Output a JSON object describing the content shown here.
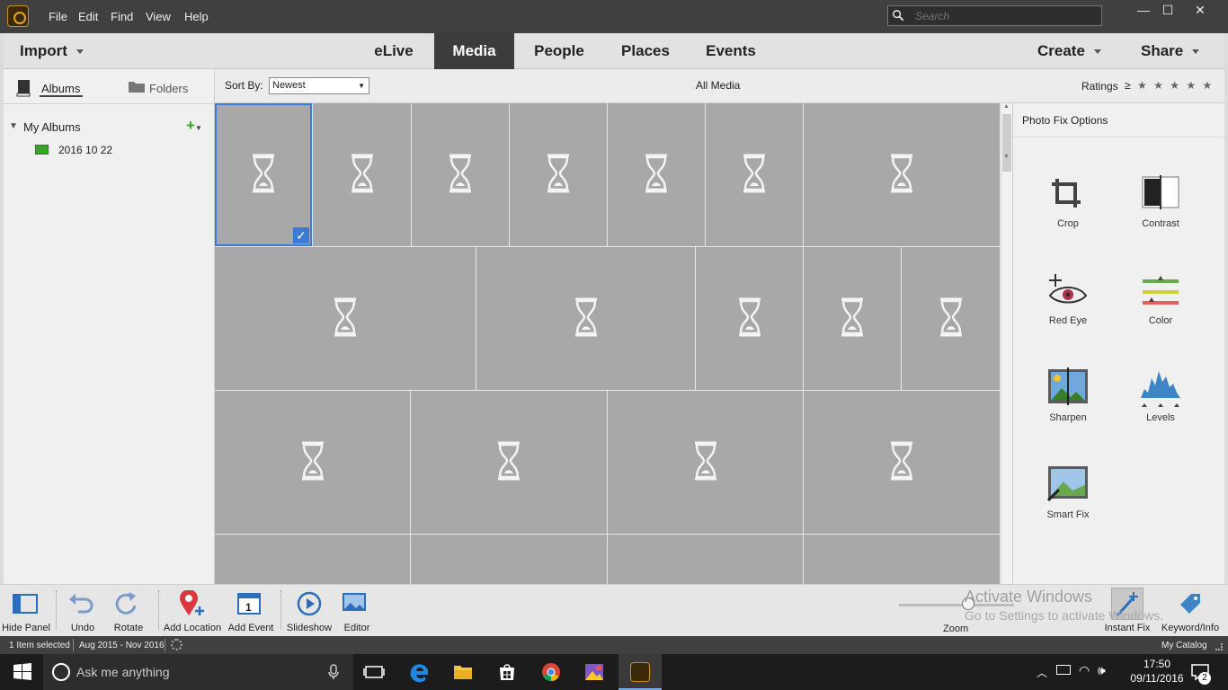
{
  "titlebar": {
    "menus": [
      "File",
      "Edit",
      "Find",
      "View",
      "Help"
    ],
    "search_placeholder": "Search",
    "window_controls": {
      "minimize": "—",
      "maximize": "☐",
      "close": "✕"
    }
  },
  "navbar": {
    "import_label": "Import",
    "tabs": [
      "eLive",
      "Media",
      "People",
      "Places",
      "Events"
    ],
    "active_tab": "Media",
    "create_label": "Create",
    "share_label": "Share"
  },
  "leftpanel": {
    "albums_label": "Albums",
    "folders_label": "Folders",
    "my_albums_label": "My Albums",
    "albums": [
      "2016 10 22"
    ]
  },
  "filterbar": {
    "sort_label": "Sort By:",
    "sort_value": "Newest",
    "view_title": "All Media",
    "ratings_label": "Ratings",
    "ratings_op": "≥"
  },
  "rightpanel": {
    "header": "Photo Fix Options",
    "tools": [
      "Crop",
      "Contrast",
      "Red Eye",
      "Color",
      "Sharpen",
      "Levels",
      "Smart Fix"
    ]
  },
  "bottombar": {
    "tools": [
      "Hide Panel",
      "Undo",
      "Rotate",
      "Add Location",
      "Add Event",
      "Slideshow",
      "Editor"
    ],
    "zoom_label": "Zoom",
    "instant_fix_label": "Instant Fix",
    "keyword_info_label": "Keyword/Info",
    "watermark_line1": "Activate Windows",
    "watermark_line2": "Go to Settings to activate Windows."
  },
  "statusbar": {
    "selection": "1 Item selected",
    "date_range": "Aug 2015 - Nov 2016",
    "catalog": "My Catalog"
  },
  "taskbar": {
    "cortana_placeholder": "Ask me anything",
    "time": "17:50",
    "date": "09/11/2016",
    "notification_count": "2"
  },
  "colors": {
    "accent": "#3a7bd5",
    "thumb": "#a8a8a8",
    "titlebar": "#404040"
  }
}
